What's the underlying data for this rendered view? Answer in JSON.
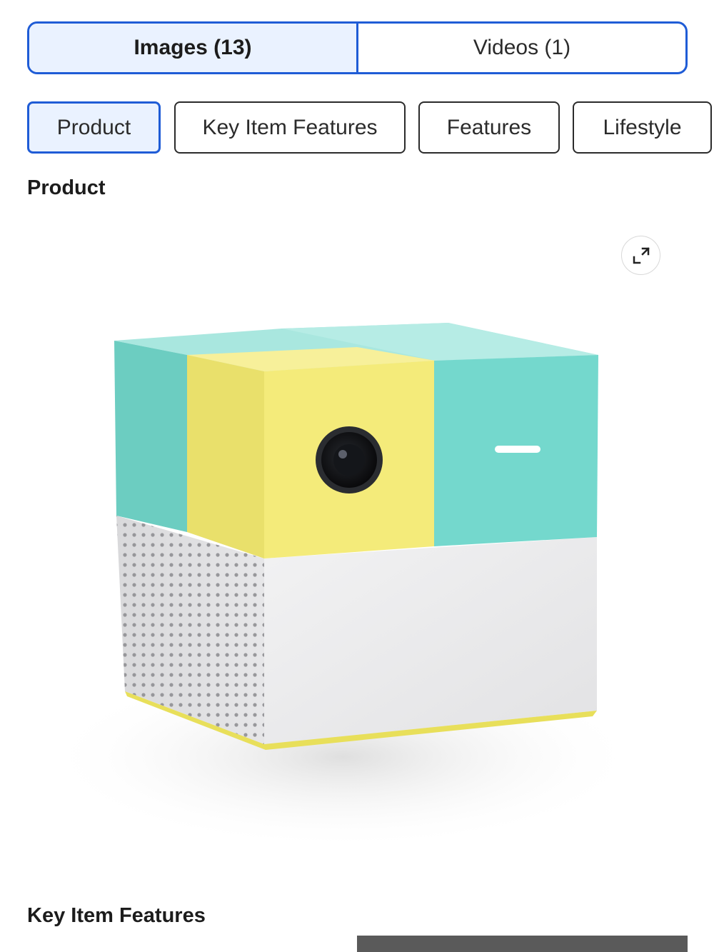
{
  "media_tabs": [
    {
      "label": "Images (13)",
      "active": true
    },
    {
      "label": "Videos (1)",
      "active": false
    }
  ],
  "category_chips": [
    {
      "label": "Product",
      "active": true
    },
    {
      "label": "Key Item Features",
      "active": false
    },
    {
      "label": "Features",
      "active": false
    },
    {
      "label": "Lifestyle",
      "active": false
    }
  ],
  "sections": {
    "current_title": "Product",
    "next_title": "Key Item Features"
  },
  "icons": {
    "expand": "expand-icon"
  },
  "colors": {
    "accent": "#1f5cd6",
    "active_fill": "#eaf2ff",
    "teal": "#72d6cc",
    "yellow": "#f3e978",
    "grey_body": "#e9e9ea"
  }
}
